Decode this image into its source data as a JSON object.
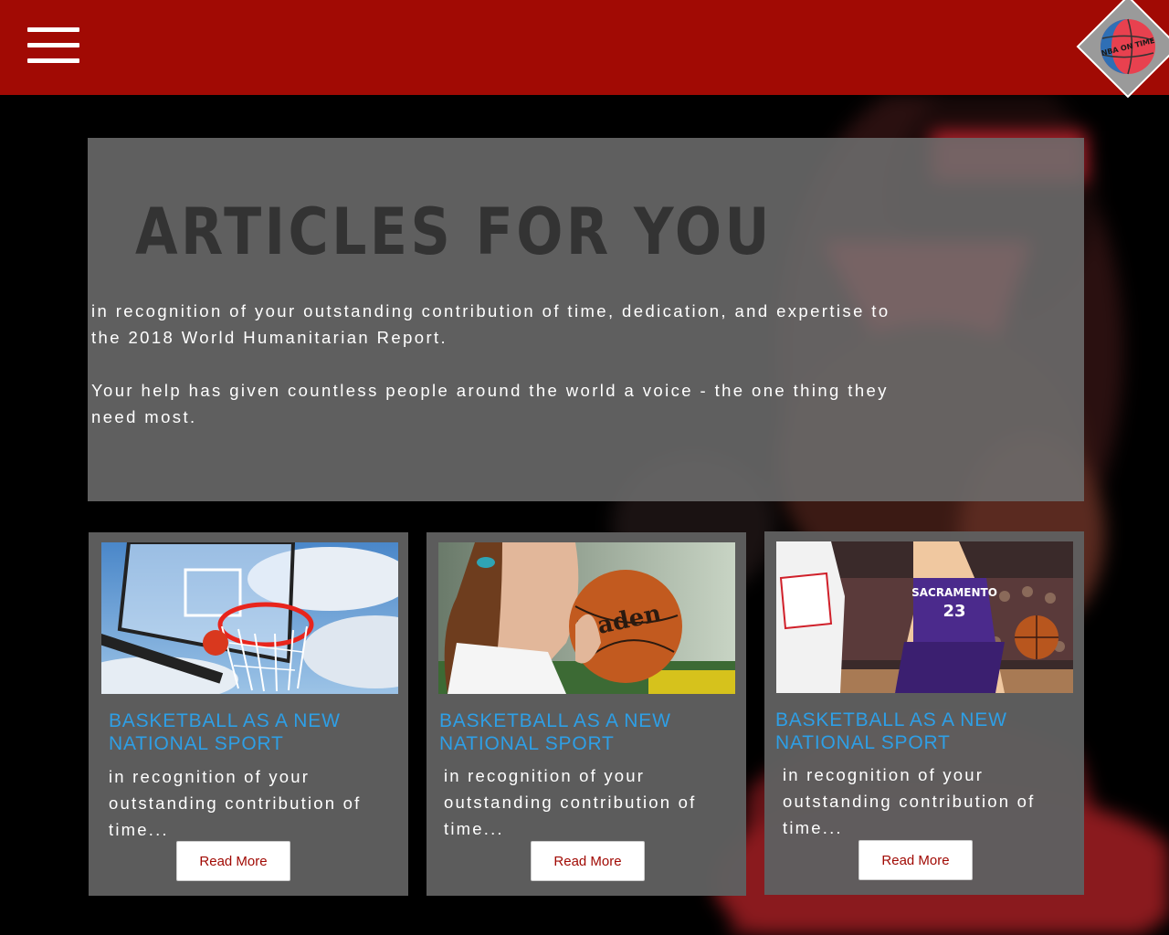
{
  "header": {
    "menu_icon": "hamburger-menu-icon",
    "logo_text": "NBA ON TIME",
    "brand_color": "#a10a04"
  },
  "hero": {
    "title": "ARTICLES FOR YOU",
    "paragraphs": [
      "in recognition of your outstanding contribution of time, dedication, and expertise to the 2018 World Humanitarian Report.",
      "Your help has given countless people around the world a voice - the one thing they need most."
    ]
  },
  "articles": [
    {
      "image": "basketball-hoop-sky-image",
      "title": "BASKETBALL AS A NEW NATIONAL SPORT",
      "excerpt": "in recognition of your outstanding contribution of time...",
      "button": "Read More"
    },
    {
      "image": "girl-holding-basketball-image",
      "title": "BASKETBALL AS A NEW NATIONAL SPORT",
      "excerpt": "in recognition of your outstanding contribution of time...",
      "button": "Read More"
    },
    {
      "image": "players-game-action-image",
      "title": "BASKETBALL AS A NEW NATIONAL SPORT",
      "excerpt": "in recognition of your outstanding contribution of time...",
      "button": "Read More"
    }
  ],
  "colors": {
    "title_blue": "#2e9fe6",
    "button_text": "#a10a04"
  }
}
